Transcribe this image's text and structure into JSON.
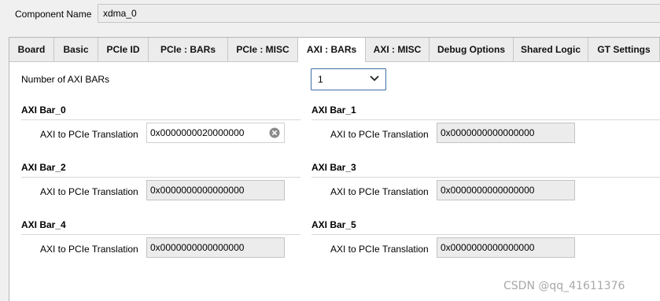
{
  "component": {
    "label": "Component Name",
    "value": "xdma_0"
  },
  "tabs": [
    {
      "label": "Board",
      "active": false
    },
    {
      "label": "Basic",
      "active": false
    },
    {
      "label": "PCIe ID",
      "active": false
    },
    {
      "label": "PCIe : BARs",
      "active": false
    },
    {
      "label": "PCIe : MISC",
      "active": false
    },
    {
      "label": "AXI : BARs",
      "active": true
    },
    {
      "label": "AXI : MISC",
      "active": false
    },
    {
      "label": "Debug Options",
      "active": false
    },
    {
      "label": "Shared Logic",
      "active": false
    },
    {
      "label": "GT Settings",
      "active": false
    }
  ],
  "num_axi_bars": {
    "label": "Number of AXI BARs",
    "selected": "1"
  },
  "bars": [
    {
      "title": "AXI Bar_0",
      "field_label": "AXI to PCIe Translation",
      "value": "0x0000000020000000"
    },
    {
      "title": "AXI Bar_1",
      "field_label": "AXI to PCIe Translation",
      "value": "0x0000000000000000"
    },
    {
      "title": "AXI Bar_2",
      "field_label": "AXI to PCIe Translation",
      "value": "0x0000000000000000"
    },
    {
      "title": "AXI Bar_3",
      "field_label": "AXI to PCIe Translation",
      "value": "0x0000000000000000"
    },
    {
      "title": "AXI Bar_4",
      "field_label": "AXI to PCIe Translation",
      "value": "0x0000000000000000"
    },
    {
      "title": "AXI Bar_5",
      "field_label": "AXI to PCIe Translation",
      "value": "0x0000000000000000"
    }
  ],
  "icons": {
    "clear": "clear-circle-x-icon",
    "dropdown": "chevron-down-icon"
  },
  "colors": {
    "focus_border": "#3f6ea6",
    "disabled_field": "#ececec",
    "watermark": "#a8a8a8"
  },
  "watermark": "CSDN @qq_41611376"
}
